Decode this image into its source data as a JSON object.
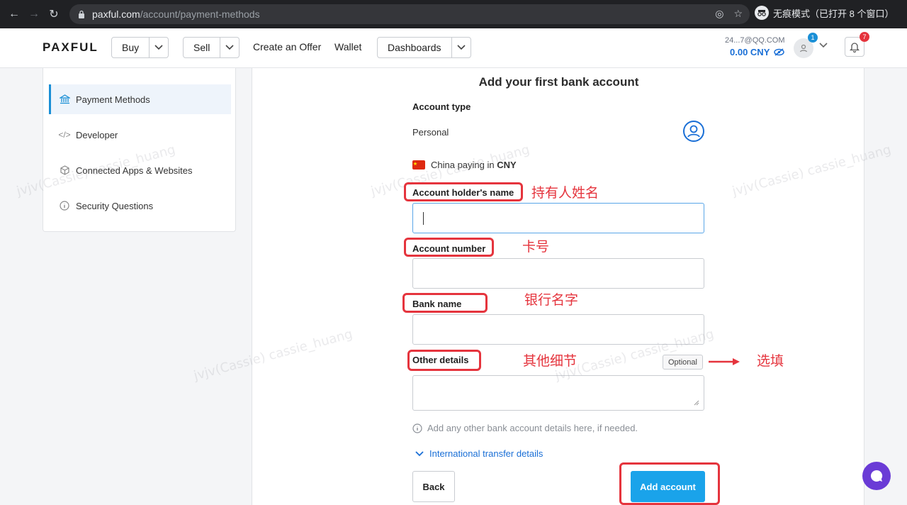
{
  "browser": {
    "url_host": "paxful.com",
    "url_path": "/account/payment-methods",
    "incognito_label": "无痕模式（已打开 8 个窗口）"
  },
  "header": {
    "logo": "PAXFUL",
    "buy_label": "Buy",
    "sell_label": "Sell",
    "create_offer_label": "Create an Offer",
    "wallet_label": "Wallet",
    "dashboards_label": "Dashboards",
    "account_email": "24...7@QQ.COM",
    "balance": "0.00 CNY",
    "avatar_badge": "1",
    "notification_badge": "7"
  },
  "sidebar": {
    "items": [
      {
        "label": "Payment Methods",
        "icon": "bank-icon",
        "active": true
      },
      {
        "label": "Developer",
        "icon": "code-icon",
        "active": false
      },
      {
        "label": "Connected Apps & Websites",
        "icon": "cube-icon",
        "active": false
      },
      {
        "label": "Security Questions",
        "icon": "info-icon",
        "active": false
      }
    ]
  },
  "form": {
    "title": "Add your first bank account",
    "account_type_label": "Account type",
    "account_type_value": "Personal",
    "country_text": "China paying in",
    "currency": "CNY",
    "holder_name_label": "Account holder's name",
    "holder_name_value": "",
    "account_number_label": "Account number",
    "account_number_value": "",
    "bank_name_label": "Bank name",
    "bank_name_value": "",
    "other_details_label": "Other details",
    "other_details_value": "",
    "optional_badge": "Optional",
    "hint": "Add any other bank account details here, if needed.",
    "intl_link": "International transfer details",
    "back_label": "Back",
    "add_label": "Add account"
  },
  "annotations": {
    "holder_name": "持有人姓名",
    "account_number": "卡号",
    "bank_name": "银行名字",
    "other_details": "其他细节",
    "optional": "选填"
  },
  "watermark": "jvjv(Cassie) cassie_huang",
  "colors": {
    "accent": "#1aa3ea",
    "link": "#1a6fd6",
    "annotation": "#e5343d",
    "chat": "#6a3bd6"
  }
}
